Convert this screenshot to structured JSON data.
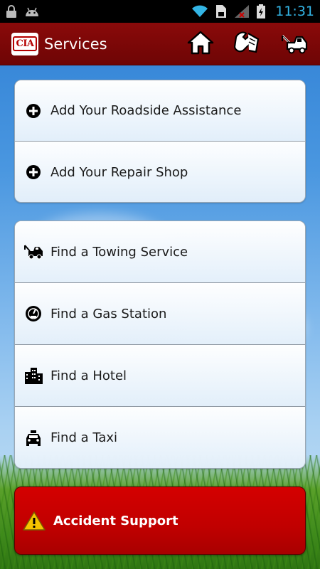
{
  "status_bar": {
    "time": "11:31"
  },
  "action_bar": {
    "logo_text": "CIA",
    "title": "Services",
    "icons": [
      "home-icon",
      "handshake-phone-icon",
      "tow-truck-icon"
    ]
  },
  "group1": {
    "items": [
      {
        "label": "Add Your Roadside Assistance",
        "icon": "plus-circle-icon"
      },
      {
        "label": "Add Your Repair Shop",
        "icon": "plus-circle-icon"
      }
    ]
  },
  "group2": {
    "items": [
      {
        "label": "Find a Towing Service",
        "icon": "tow-truck-icon"
      },
      {
        "label": "Find a Gas Station",
        "icon": "gauge-icon"
      },
      {
        "label": "Find a Hotel",
        "icon": "hotel-icon"
      },
      {
        "label": "Find a Taxi",
        "icon": "taxi-icon"
      }
    ]
  },
  "accident": {
    "label": "Accident Support",
    "icon": "warning-icon"
  },
  "colors": {
    "action_bar": "#7a0808",
    "accident": "#c80000",
    "time": "#33b5e5"
  }
}
